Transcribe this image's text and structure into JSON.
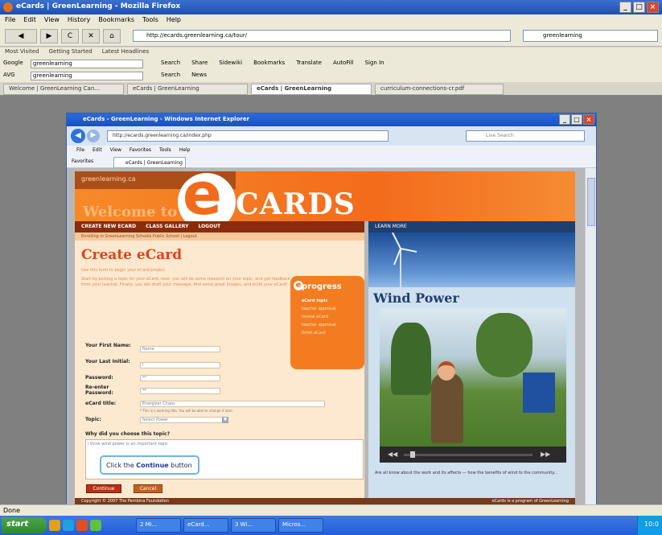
{
  "firefox": {
    "title": "eCards | GreenLearning - Mozilla Firefox",
    "menu": [
      "File",
      "Edit",
      "View",
      "History",
      "Bookmarks",
      "Tools",
      "Help"
    ],
    "url": "http://ecards.greenlearning.ca/tour/",
    "search_value": "greenlearning",
    "bookmarks": [
      "Most Visited",
      "Getting Started",
      "Latest Headlines"
    ],
    "google_label": "Google",
    "google_value": "greenlearning",
    "google_items": [
      "Search",
      "Share",
      "Sidewiki",
      "Bookmarks",
      "Translate",
      "AutoFill",
      "Sign In"
    ],
    "avg_label": "AVG",
    "avg_value": "greenlearning",
    "avg_items": [
      "Search",
      "News"
    ],
    "tabs": [
      "Welcome | GreenLearning Can...",
      "eCards | GreenLearning",
      "eCards | GreenLearning",
      "curriculum-connections-cr.pdf"
    ],
    "status": "Done"
  },
  "ie": {
    "title": "eCards - GreenLearning - Windows Internet Explorer",
    "url": "http://ecards.greenlearning.ca/index.php",
    "search_placeholder": "Live Search",
    "menu": [
      "File",
      "Edit",
      "View",
      "Favorites",
      "Tools",
      "Help"
    ],
    "favorites": "Favorites",
    "tab": "eCards | GreenLearning"
  },
  "page": {
    "site": "greenlearning.ca",
    "welcome": "Welcome to",
    "e": "e",
    "cards": "CARDS",
    "nav": [
      "CREATE NEW ECARD",
      "CLASS GALLERY",
      "LOGOUT"
    ],
    "rnav": "LEARN MORE",
    "subnav": "Enrolling in GreenLearning Schools Public School | Logout",
    "heading": "Create eCard",
    "intro1": "Use this form to begin your eCard project.",
    "intro2": "Start by picking a topic for your eCard, next, you will do some research on your topic, and get feedback from your teacher. Finally, you will draft your message, find some great images, and build your eCard!",
    "progress_title": "progress",
    "progress_steps": [
      "eCard topic",
      "teacher approval",
      "review eCard",
      "teacher approval",
      "finish eCard"
    ],
    "fields": [
      {
        "label": "Your First Name:",
        "value": "Name"
      },
      {
        "label": "Your Last Initial:",
        "value": "I"
      },
      {
        "label": "Password:",
        "value": "**"
      },
      {
        "label": "Re-enter Password:",
        "value": "**"
      },
      {
        "label": "eCard title:",
        "value": "Energizer Chaos"
      },
      {
        "label": "Topic:",
        "value": "Select Power"
      }
    ],
    "title_hint": "* This is a working title. You will be able to change it later.",
    "why_label": "Why did you choose this topic?",
    "why_value": "I think wind power is an important topic",
    "tooltip_prefix": "Click the ",
    "tooltip_bold": "Continue",
    "tooltip_suffix": " button",
    "continue": "Continue",
    "cancel": "Cancel",
    "right_heading": "Wind Power",
    "right_para": "Are all know about the work and its affects — how the benefits of wind to the community...",
    "footer_left": "Copyright © 2007 The Pembina Foundation",
    "footer_right": "eCards is a program of GreenLearning"
  },
  "taskbar": {
    "start": "start",
    "buttons": [
      "2 Mi...",
      "eCard...",
      "3 Wi...",
      "Micros..."
    ],
    "clock": "10:0"
  }
}
